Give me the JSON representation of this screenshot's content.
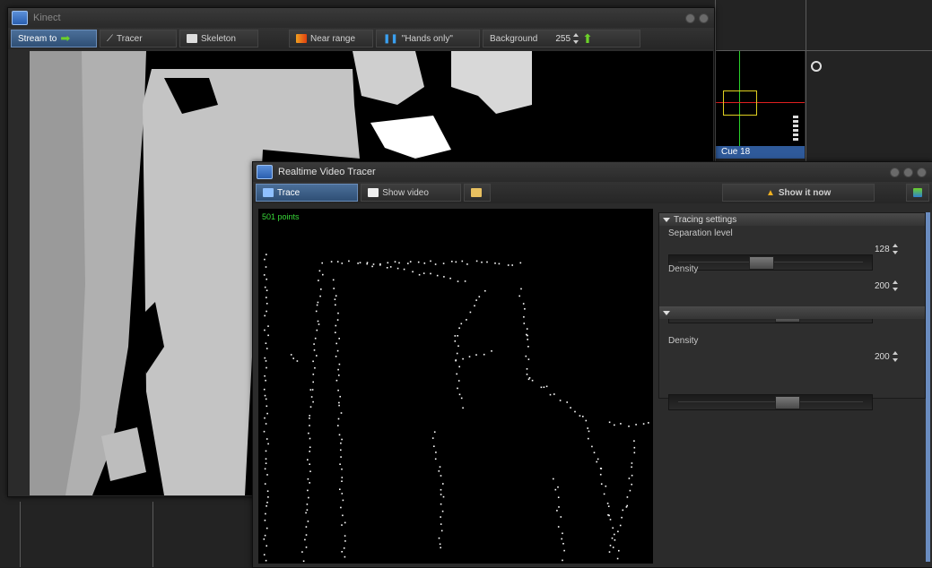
{
  "kinect_window": {
    "title": "Kinect",
    "toolbar": {
      "stream_to": "Stream to",
      "tracer": "Tracer",
      "skeleton": "Skeleton",
      "near_range": "Near range",
      "hands_only": "\"Hands only\"",
      "background_label": "Background",
      "background_value": "255"
    }
  },
  "preview": {
    "cue_label": "Cue 18"
  },
  "tracer_window": {
    "title": "Realtime Video Tracer",
    "toolbar": {
      "trace": "Trace",
      "show_video": "Show video",
      "show_it_now": "Show it now"
    },
    "points_label": "501 points",
    "tracing_settings": {
      "header": "Tracing settings",
      "separation_label": "Separation level",
      "separation_value": "128",
      "separation_fraction": 0.44,
      "density_label": "Density",
      "density_value": "200",
      "density_fraction": 0.6
    },
    "second_section": {
      "density_label": "Density",
      "density_value": "200",
      "density_fraction": 0.6
    }
  },
  "colors": {
    "accent_blue": "#2f4f75",
    "green_arrow": "#6cd12a",
    "points_green": "#38d838",
    "warning_yellow": "#f0b020"
  }
}
